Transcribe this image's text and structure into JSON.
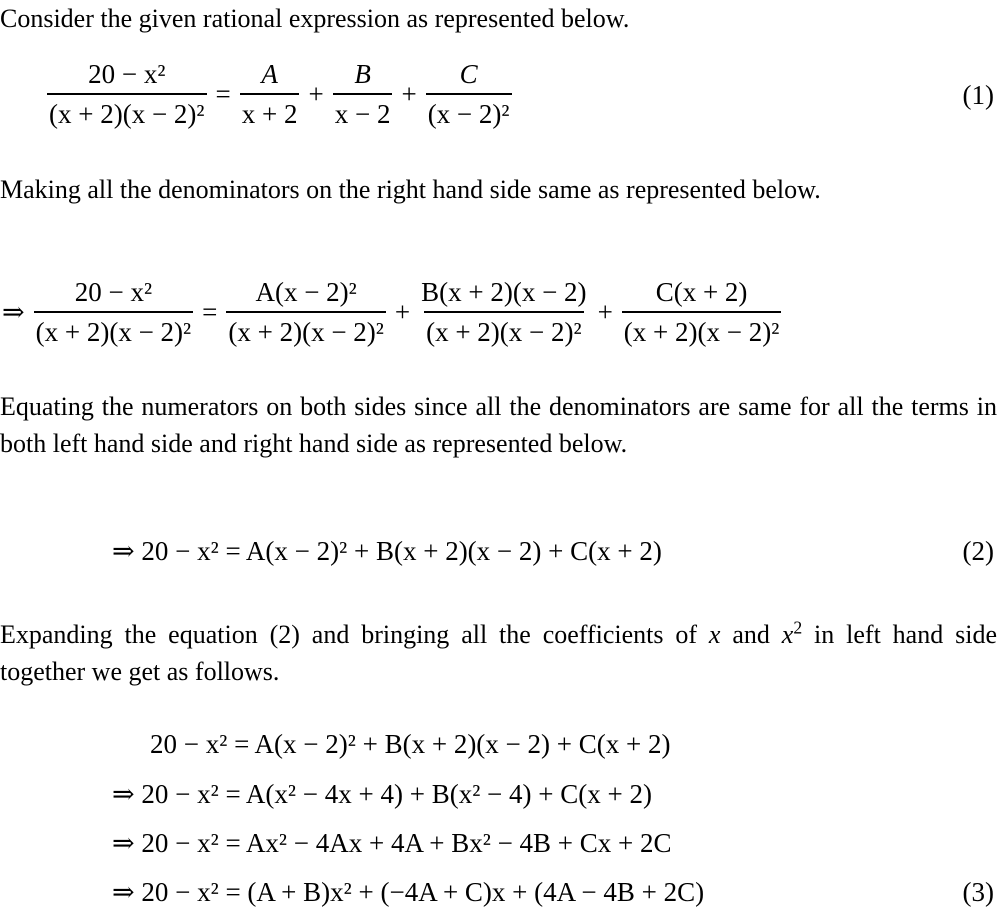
{
  "paragraphs": {
    "p1": "Consider the given rational expression as represented below.",
    "p2": "Making all the denominators on the right hand side same as represented below.",
    "p3": "Equating the numerators on both sides since all the denominators are same for all the terms in both left hand side and right hand side as represented below.",
    "p4_a": "Expanding the equation (2) and bringing all the coefficients of ",
    "p4_x": "x",
    "p4_and": " and ",
    "p4_x2": "x",
    "p4_sup": "2",
    "p4_b": " in left hand side together we get as follows."
  },
  "eq1": {
    "lhs_num": "20 − x²",
    "lhs_den": "(x + 2)(x − 2)²",
    "t1_num": "A",
    "t1_den": "x + 2",
    "t2_num": "B",
    "t2_den": "x − 2",
    "t3_num": "C",
    "t3_den": "(x − 2)²",
    "label": "(1)"
  },
  "eq_common": {
    "arrow": "⇒",
    "lhs_num": "20 − x²",
    "lhs_den": "(x + 2)(x − 2)²",
    "t1_num": "A(x − 2)²",
    "t1_den": "(x + 2)(x − 2)²",
    "t2_num": "B(x + 2)(x − 2)",
    "t2_den": "(x + 2)(x − 2)²",
    "t3_num": "C(x + 2)",
    "t3_den": "(x + 2)(x − 2)²"
  },
  "eq2": {
    "text": "⇒ 20 − x² = A(x − 2)² + B(x + 2)(x − 2) + C(x + 2)",
    "label": "(2)"
  },
  "eq3_lines": [
    "20 − x² = A(x − 2)² + B(x + 2)(x − 2) + C(x + 2)",
    "⇒ 20 − x² = A(x² − 4x + 4) + B(x² − 4) + C(x + 2)",
    "⇒ 20 − x² = Ax² − 4Ax + 4A + Bx² − 4B + Cx + 2C",
    "⇒ 20 − x² = (A + B)x² + (−4A + C)x + (4A − 4B + 2C)"
  ],
  "eq3_label": "(3)",
  "operators": {
    "eq": "=",
    "plus": "+"
  }
}
